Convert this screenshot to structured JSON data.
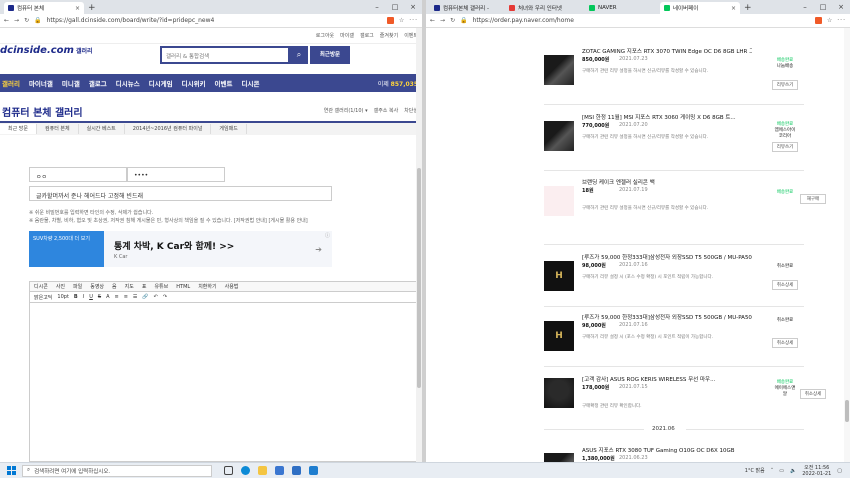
{
  "left": {
    "tab_title": "컴퓨터 본체",
    "url": "https://gall.dcinside.com/board/write/?id=pridepc_new4",
    "header_links": [
      "로그아웃",
      "마이갤",
      "갤로그",
      "즐겨찾기",
      "이벤트"
    ],
    "logo": "dcinside.com",
    "logo_sub": "갤러리",
    "search_placeholder": "갤러리 & 통합검색",
    "recent_btn": "최근방문",
    "nav": [
      "갤러리",
      "마이너갤",
      "미니갤",
      "갤로그",
      "디시뉴스",
      "디시게임",
      "디시위키",
      "이벤트",
      "디시콘"
    ],
    "visitor_label": "이제",
    "visitor_count": "857,035",
    "gallery_title": "컴퓨터 본체 갤러리",
    "gallery_side": [
      "연관 갤러리(1/10) ▾",
      "갤주소 복사",
      "차단설"
    ],
    "gallery_tabs": [
      "최근 방문",
      "컴퓨터 본체",
      "실시간 베스트",
      "2014년~2016년 컴퓨터 파이널",
      "게임패드"
    ],
    "field_name": "ㅇㅇ",
    "field_pass": "••••",
    "field_subject": "글카할머까서 준나 헤어드다 고정해 빈드래",
    "note1": "※ 쉬운 비밀번호를 입력하면 타인의 수정, 삭제가 쉽습니다.",
    "note2": "※ 음란물, 차별, 비하, 혐오 및 초상권, 저작권 침해 게시물은 민, 형사상의 책임을 질 수 있습니다. [저작권법 안내] [게시물 활용 안내]",
    "ad_img_text": "SUV차량 2,500대 더 보기",
    "ad_title": "통계 차박, K Car와 함께! >>",
    "ad_sub": "K Car",
    "ad_arrow": "➔",
    "ad_info": "ⓘ",
    "toolbar1": [
      "디시콘",
      "사진",
      "파일",
      "동영상",
      "음",
      "지도",
      "표",
      "유튜브",
      "HTML",
      "치환하기",
      "사용법"
    ],
    "toolbar2": [
      "맑은고딕",
      "10pt"
    ]
  },
  "right": {
    "tabs": [
      "컴퓨터본체 갤러리 - ",
      "처녀와 우리 인터넷",
      "NAVER",
      "네이버페이"
    ],
    "url": "https://order.pay.naver.com/home",
    "orders": [
      {
        "title": "ZOTAC GAMING 지포스 RTX 3070 TWIN Edge OC D6 8GB LHR 그...",
        "price": "850,000원",
        "date": "2021.07.23",
        "desc": "구매하기 관련 리뷰 설정을 하시면 신규/리뷰를 작성할 수 있습니다.",
        "status": "배송완료",
        "status2": "나눔배송",
        "btn": "리뷰쓰기"
      },
      {
        "title": "[MSI 한정 11월] MSI 지포스 RTX 3060 게이밍 X D6 8GB 트...",
        "price": "770,000원",
        "date": "2021.07.20",
        "desc": "구매하기 관련 리뷰 설정을 하시면 신규/리뷰를 작성할 수 있습니다.",
        "status": "배송완료",
        "status2": "엠에스아이코리아",
        "btn": "리뷰쓰기"
      },
      {
        "title": "브랜딩 케이크 엔젤러 실리콘 백",
        "price": "18원",
        "date": "2021.07.19",
        "desc": "구매하기 관련 리뷰 설정을 하시면 신규/리뷰를 작성할 수 있습니다.",
        "status": "배송완료",
        "status2": "",
        "btn": "재구매"
      },
      {
        "title": "[루즈가 59,000 한정333대]삼성전자 외장SSD T5 500GB / MU-PA500",
        "price": "98,000원",
        "date": "2021.07.16",
        "desc": "구매하기 리뷰 설정 시 (포스 수정 확정) 시 포인트 적립이 가능합니다.",
        "status": "취소완료",
        "status2": "",
        "btn": "취소상세"
      },
      {
        "title": "[루즈가 59,000 한정333대]삼성전자 외장SSD T5 500GB / MU-PA500",
        "price": "98,000원",
        "date": "2021.07.16",
        "desc": "구매하기 리뷰 설정 시 (포스 수정 확정) 시 포인트 적립이 가능합니다.",
        "status": "취소완료",
        "status2": "",
        "btn": "취소상세"
      },
      {
        "title": "[고객 감사] ASUS ROG KERIS WIRELESS 무선 마우...",
        "price": "178,000원",
        "date": "2021.07.15",
        "desc": "구매확정 관련 리뷰 확인합니다.",
        "status": "배송완료",
        "status2": "에이에스앤알",
        "btn": "취소상세"
      }
    ],
    "date_separator": "2021.06",
    "last_order": {
      "title": "ASUS 지포스 RTX 3080 TUF Gaming O10G OC D6X 10GB",
      "price": "1,380,000원",
      "date": "2021.06.23"
    }
  },
  "taskbar": {
    "search_placeholder": "검색하려면 여기에 입력하십시오.",
    "weather": "1°C 맑음",
    "time": "오전 11:56",
    "date": "2022-01-21"
  }
}
